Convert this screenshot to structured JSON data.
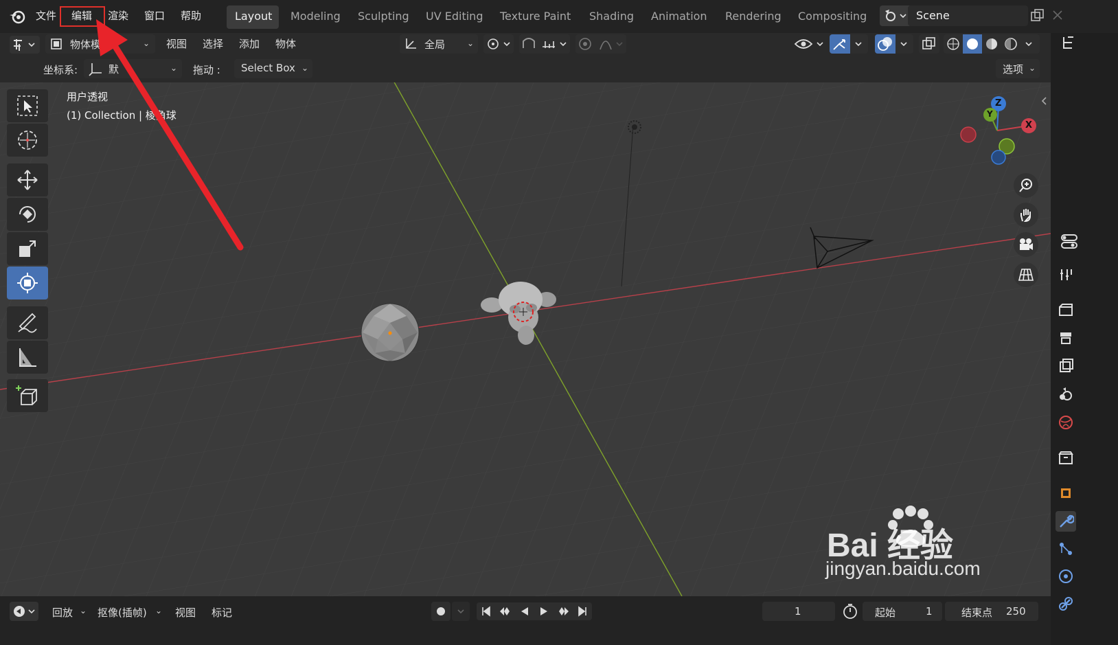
{
  "menu": {
    "file": "文件",
    "edit": "编辑",
    "render": "渲染",
    "window": "窗口",
    "help": "帮助"
  },
  "workspaces": [
    "Layout",
    "Modeling",
    "Sculpting",
    "UV Editing",
    "Texture Paint",
    "Shading",
    "Animation",
    "Rendering",
    "Compositing"
  ],
  "scene": {
    "name": "Scene"
  },
  "header": {
    "mode": "物体模",
    "view": "视图",
    "select": "选择",
    "add": "添加",
    "object": "物体",
    "transform_orientation": "全局"
  },
  "tool_settings": {
    "coord_label": "坐标系:",
    "coord_value": "默",
    "drag_label": "拖动 :",
    "drag_value": "Select Box",
    "options": "选项"
  },
  "viewport": {
    "perspective": "用户透视",
    "collection_info": "(1) Collection | 棱角球"
  },
  "gizmo": {
    "x": "X",
    "y": "Y",
    "z": "Z"
  },
  "timeline": {
    "playback": "回放",
    "keying": "抠像(插帧)",
    "view": "视图",
    "marker": "标记",
    "current_frame": "1",
    "start_label": "起始",
    "start_value": "1",
    "end_label": "结束点",
    "end_value": "250"
  },
  "watermark": {
    "brand": "Bai 经验",
    "url": "jingyan.baidu.com"
  },
  "colors": {
    "accent": "#4772b3",
    "highlight_box": "#e0302a",
    "arrow": "#e8242a",
    "x_axis": "#c8404a",
    "y_axis": "#7fa32a"
  }
}
